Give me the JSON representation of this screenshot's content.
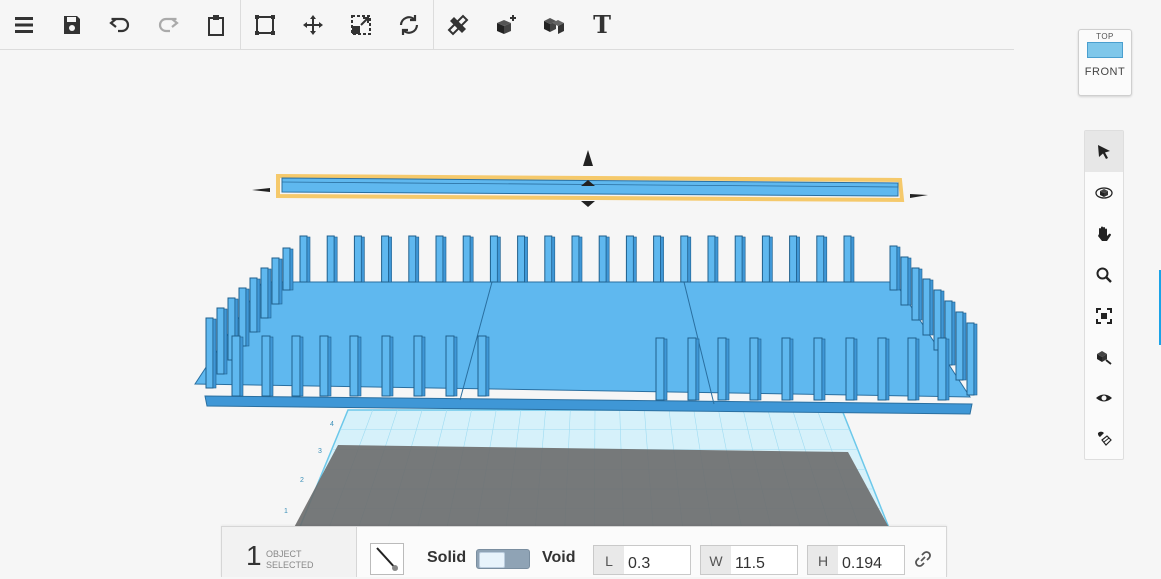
{
  "toolbar": {
    "left_group": [
      {
        "name": "menu-icon"
      },
      {
        "name": "save-icon"
      },
      {
        "name": "undo-icon"
      },
      {
        "name": "redo-icon"
      },
      {
        "name": "paste-icon"
      }
    ],
    "middle_group": [
      {
        "name": "fit-icon"
      },
      {
        "name": "move-icon"
      },
      {
        "name": "scale-icon"
      },
      {
        "name": "rotate-icon"
      }
    ],
    "right_group": [
      {
        "name": "ruler-icon"
      },
      {
        "name": "add-shape-icon"
      },
      {
        "name": "group-icon"
      },
      {
        "name": "text-icon",
        "glyph": "T"
      }
    ]
  },
  "viewcube": {
    "top_label": "TOP",
    "front_label": "FRONT"
  },
  "right_tools": [
    {
      "name": "select-icon",
      "active": true
    },
    {
      "name": "orbit-icon"
    },
    {
      "name": "pan-icon"
    },
    {
      "name": "zoom-icon"
    },
    {
      "name": "fit-view-icon"
    },
    {
      "name": "workplane-icon"
    },
    {
      "name": "visibility-icon"
    },
    {
      "name": "snap-icon"
    }
  ],
  "grid_labels": [
    "1",
    "2",
    "3",
    "4"
  ],
  "selection": {
    "count": "1",
    "label_line1": "OBJECT",
    "label_line2": "SELECTED"
  },
  "properties": {
    "solid_label": "Solid",
    "void_label": "Void",
    "length": {
      "key": "L",
      "value": "0.3"
    },
    "width": {
      "key": "W",
      "value": "11.5"
    },
    "height": {
      "key": "H",
      "value": "0.194"
    }
  },
  "colors": {
    "accent": "#1aa3e8",
    "shape_fill": "#5fb8ef",
    "shape_dark": "#3f97d6",
    "grid_line": "#7fd4f0",
    "selection_outline": "#f5c96b"
  }
}
